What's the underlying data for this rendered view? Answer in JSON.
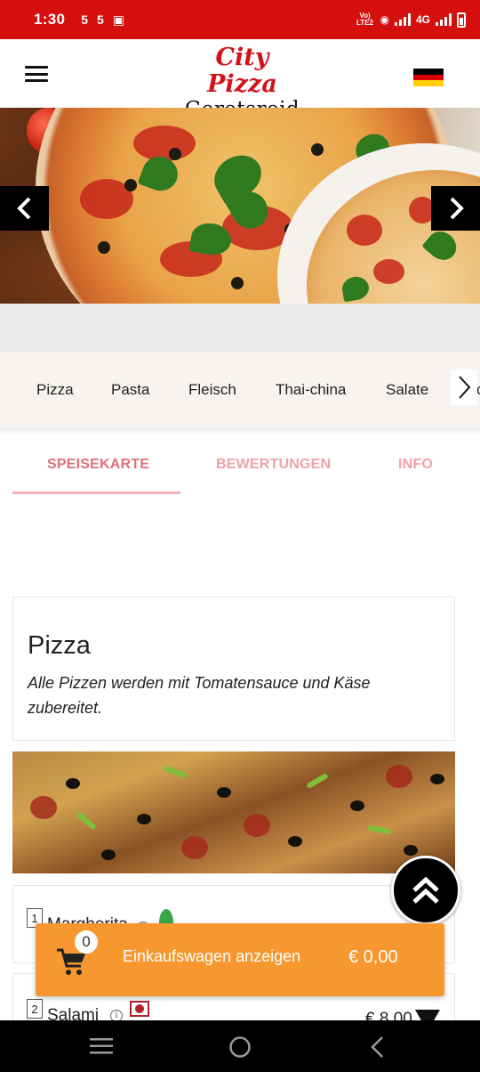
{
  "status_bar": {
    "time": "1:30",
    "left_icons": [
      "5",
      "5"
    ],
    "network_label": "Vo) LTE2",
    "network_type": "4G"
  },
  "header": {
    "logo_line1": "City Pizza",
    "logo_line2": "Geretsreid",
    "menu_icon": "hamburger-icon",
    "language_icon": "german-flag-icon",
    "flag_colors": [
      "#000000",
      "#dd0000",
      "#ffce00"
    ]
  },
  "hero": {
    "prev_icon": "chevron-left-icon",
    "next_icon": "chevron-right-icon"
  },
  "categories": {
    "items": [
      "Pizza",
      "Pasta",
      "Fleisch",
      "Thai-china",
      "Salate"
    ],
    "overflow_peek": "c",
    "next_icon": "chevron-right-icon"
  },
  "tabs": [
    {
      "label": "SPEISEKARTE",
      "active": true
    },
    {
      "label": "BEWERTUNGEN",
      "active": false
    },
    {
      "label": "INFO",
      "active": false
    }
  ],
  "section": {
    "title": "Pizza",
    "description": "Alle Pizzen werden mit Tomatensauce und Käse zubereitet."
  },
  "items": [
    {
      "number": "1",
      "name": "Margherita",
      "icons": [
        "info-icon",
        "vegetarian-leaf-icon"
      ]
    },
    {
      "number": "2",
      "name": "Salami",
      "icons": [
        "info-icon",
        "spicy-icon"
      ],
      "price": "€ 8,00"
    }
  ],
  "cart": {
    "count": "0",
    "label": "Einkaufswagen anzeigen",
    "total": "€ 0,00",
    "color": "#f6982f"
  },
  "colors": {
    "status_bar": "#d50e0e",
    "logo_red": "#d4121b",
    "tab_active": "#e0707c",
    "tab_inactive": "#f0a0a8"
  }
}
